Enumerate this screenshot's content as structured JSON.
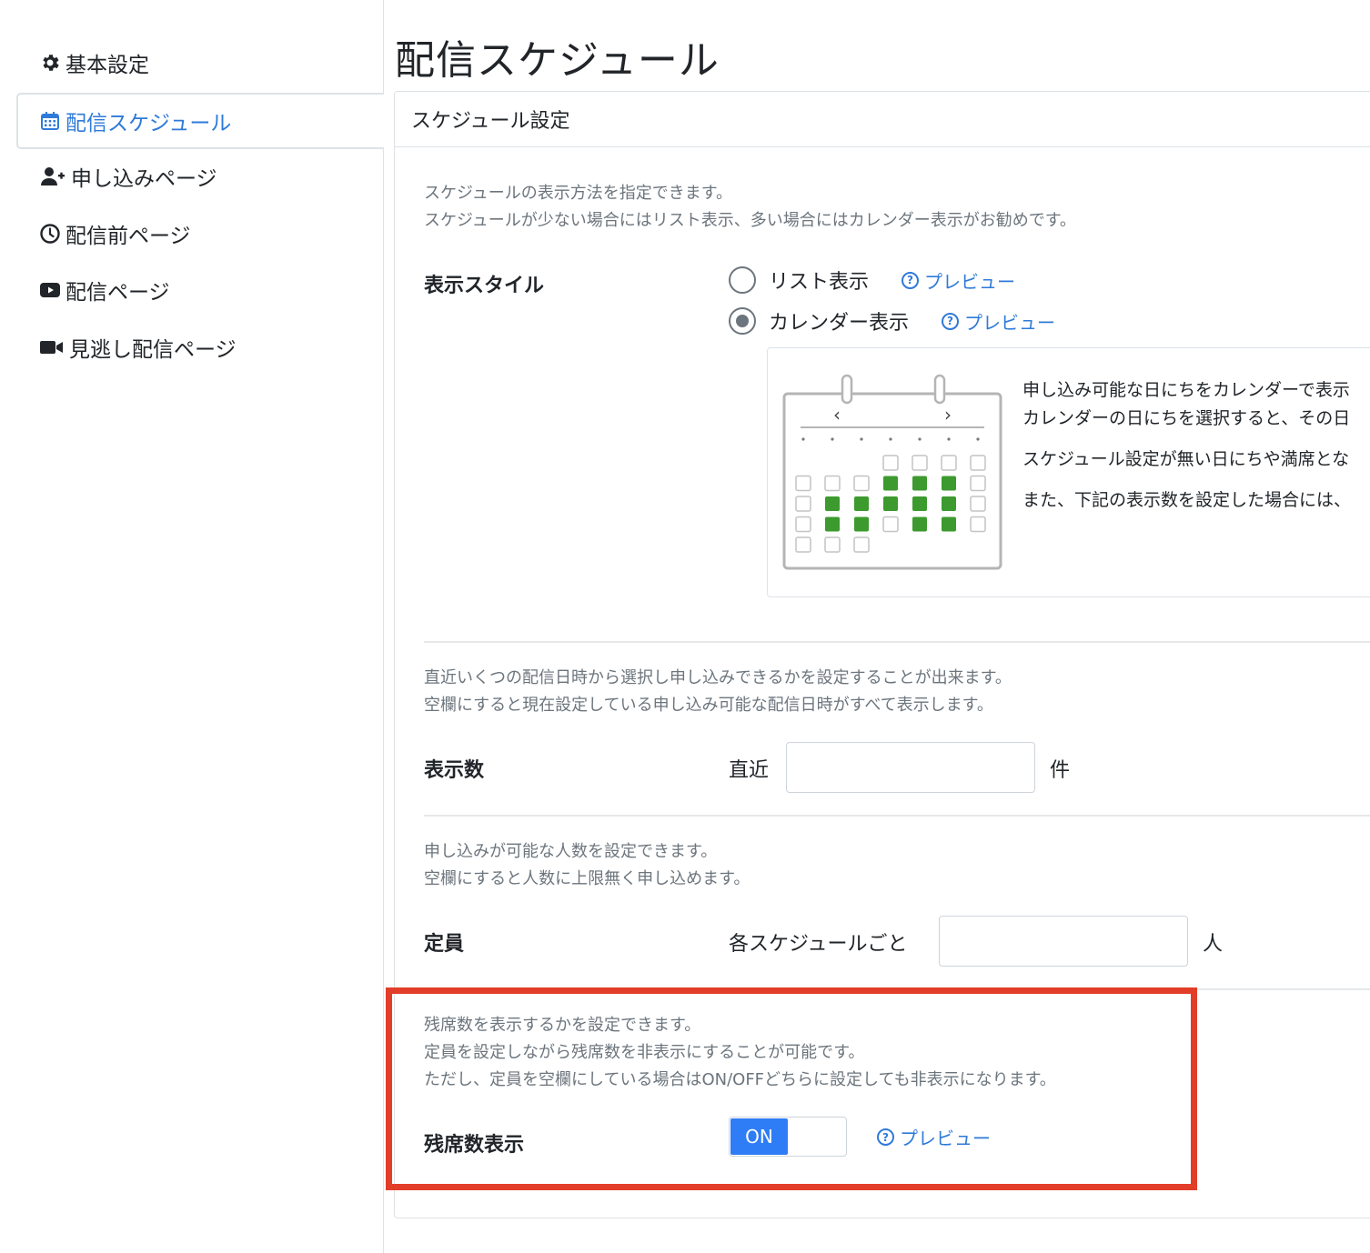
{
  "sidebar": {
    "items": [
      {
        "label": "基本設定",
        "icon": "gear-icon",
        "active": false
      },
      {
        "label": "配信スケジュール",
        "icon": "calendar-icon",
        "active": true
      },
      {
        "label": "申し込みページ",
        "icon": "user-plus-icon",
        "active": false
      },
      {
        "label": "配信前ページ",
        "icon": "clock-icon",
        "active": false
      },
      {
        "label": "配信ページ",
        "icon": "youtube-icon",
        "active": false
      },
      {
        "label": "見逃し配信ページ",
        "icon": "video-camera-icon",
        "active": false
      }
    ]
  },
  "page_title": "配信スケジュール",
  "card": {
    "header": "スケジュール設定",
    "style_section": {
      "desc": [
        "スケジュールの表示方法を指定できます。",
        "スケジュールが少ない場合にはリスト表示、多い場合にはカレンダー表示がお勧めです。"
      ],
      "label": "表示スタイル",
      "options": [
        {
          "label": "リスト表示",
          "checked": false,
          "preview": "プレビュー"
        },
        {
          "label": "カレンダー表示",
          "checked": true,
          "preview": "プレビュー"
        }
      ],
      "calendar_desc": [
        "申し込み可能な日にちをカレンダーで表示",
        "カレンダーの日にちを選択すると、その日",
        "スケジュール設定が無い日にちや満席とな",
        "また、下記の表示数を設定した場合には、"
      ],
      "calendar_prev": "‹",
      "calendar_next": "›"
    },
    "count_section": {
      "desc": [
        "直近いくつの配信日時から選択し申し込みできるかを設定することが出来ます。",
        "空欄にすると現在設定している申し込み可能な配信日時がすべて表示します。"
      ],
      "label": "表示数",
      "prefix": "直近",
      "value": "",
      "suffix": "件"
    },
    "capacity_section": {
      "desc": [
        "申し込みが可能な人数を設定できます。",
        "空欄にすると人数に上限無く申し込めます。"
      ],
      "label": "定員",
      "prefix": "各スケジュールごと",
      "value": "",
      "suffix": "人"
    },
    "remaining_section": {
      "desc": [
        "残席数を表示するかを設定できます。",
        "定員を設定しながら残席数を非表示にすることが可能です。",
        "ただし、定員を空欄にしている場合はON/OFFどちらに設定しても非表示になります。"
      ],
      "label": "残席数表示",
      "toggle_label": "ON",
      "preview": "プレビュー"
    }
  },
  "colors": {
    "accent": "#2f7ad9",
    "toggle_on": "#2e7cf6",
    "highlight": "#e23d28",
    "calendar_green": "#3c9a2e"
  }
}
